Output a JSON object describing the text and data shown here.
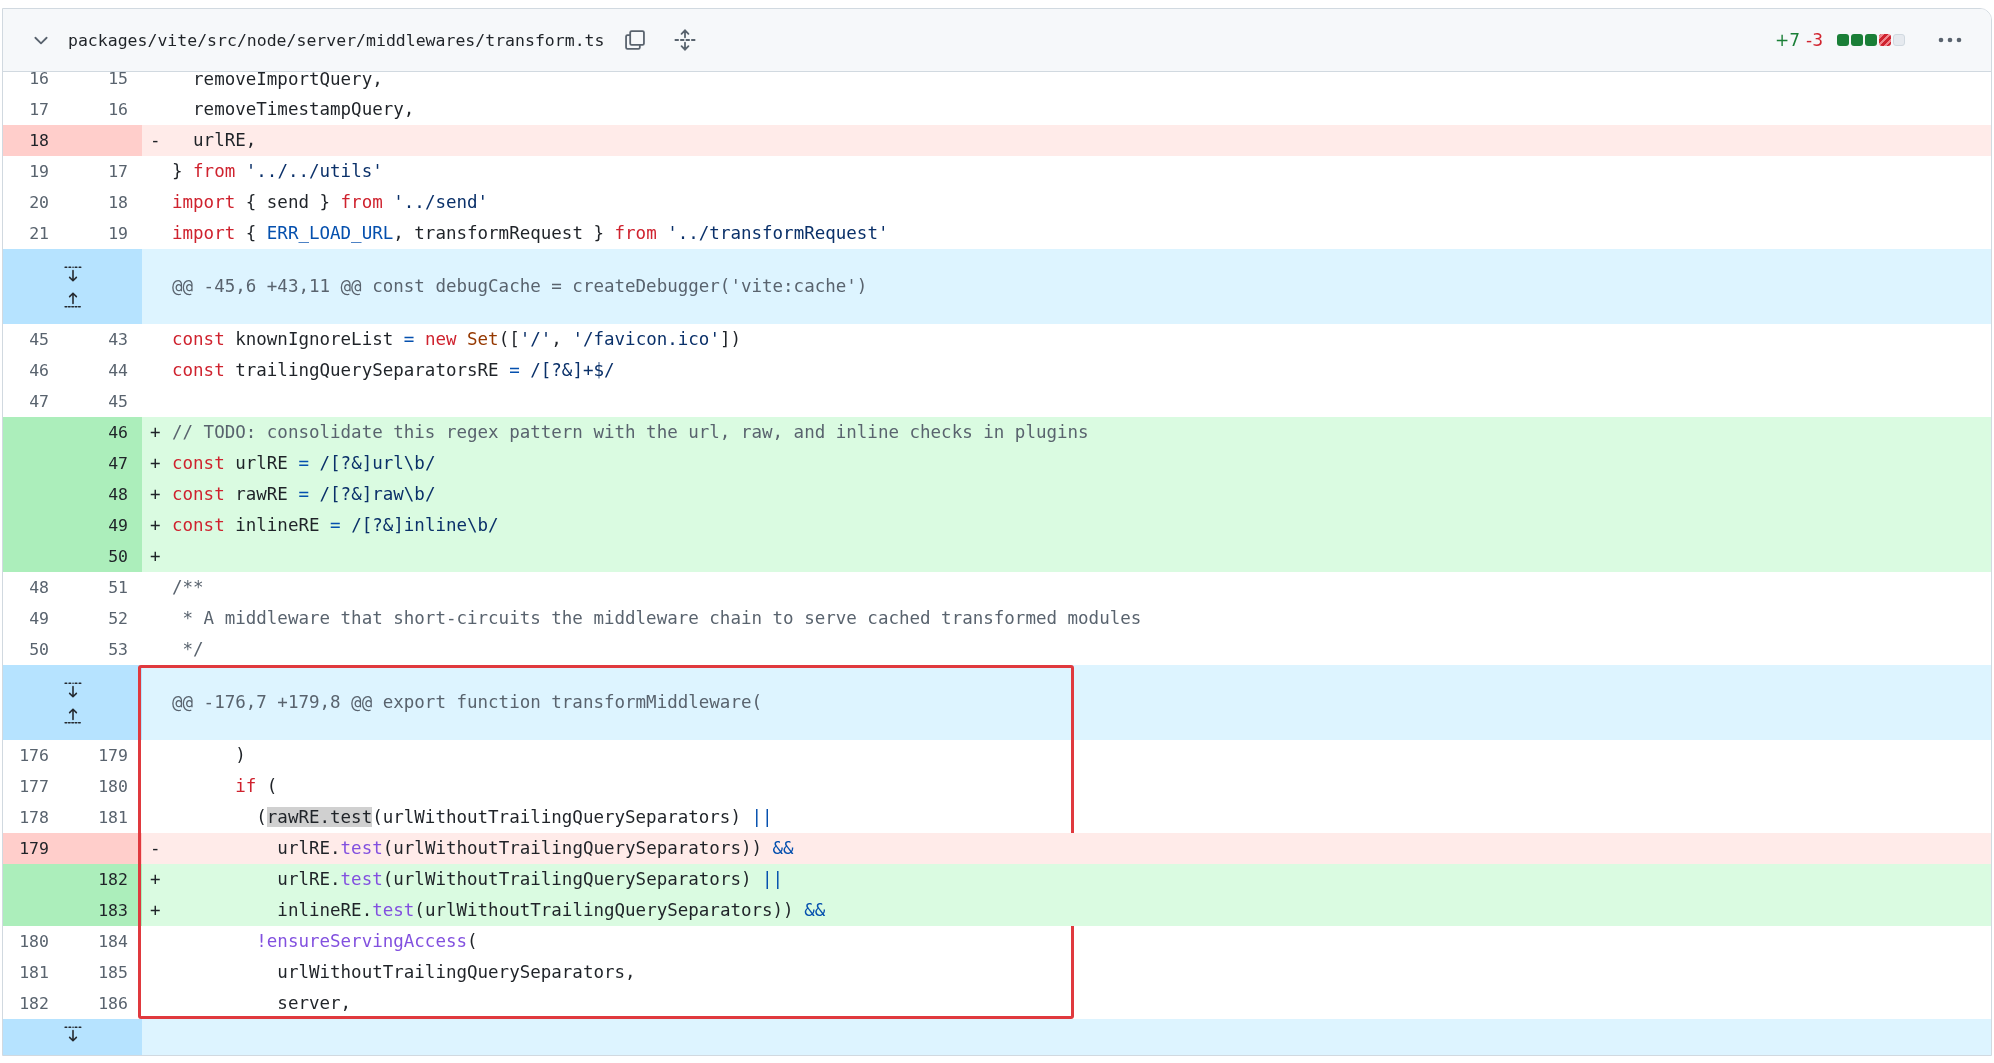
{
  "file_header": {
    "expanded": true,
    "path": "packages/vite/src/node/server/middlewares/transform.ts",
    "additions": "+7",
    "deletions": "-3",
    "diffstat": [
      {
        "kind": "added"
      },
      {
        "kind": "added"
      },
      {
        "kind": "added"
      },
      {
        "kind": "deleted"
      },
      {
        "kind": "neutral"
      }
    ]
  },
  "rows": [
    {
      "kind": "context",
      "old": "16",
      "new": "15",
      "cut": true,
      "tokens": [
        {
          "text": "  removeImportQuery,"
        }
      ]
    },
    {
      "kind": "context",
      "old": "17",
      "new": "16",
      "tokens": [
        {
          "text": "  removeTimestampQuery,"
        }
      ]
    },
    {
      "kind": "deletion",
      "old": "18",
      "marker": "-",
      "tokens": [
        {
          "text": "  urlRE,"
        }
      ]
    },
    {
      "kind": "context",
      "old": "19",
      "new": "17",
      "tokens": [
        {
          "text": "} "
        },
        {
          "kind": "kw",
          "text": "from"
        },
        {
          "kind": "str",
          "text": " '../../utils'"
        }
      ]
    },
    {
      "kind": "context",
      "old": "20",
      "new": "18",
      "tokens": [
        {
          "kind": "kw",
          "text": "import"
        },
        {
          "text": " { send } "
        },
        {
          "kind": "kw",
          "text": "from"
        },
        {
          "kind": "str",
          "text": " '../send'"
        }
      ]
    },
    {
      "kind": "context",
      "old": "21",
      "new": "19",
      "tokens": [
        {
          "kind": "kw",
          "text": "import"
        },
        {
          "text": " { "
        },
        {
          "kind": "const",
          "text": "ERR_LOAD_URL"
        },
        {
          "text": ", transformRequest } "
        },
        {
          "kind": "kw",
          "text": "from"
        },
        {
          "kind": "str",
          "text": " '../transformRequest'"
        }
      ]
    },
    {
      "kind": "hunk",
      "expand_up": true,
      "expand_down": true,
      "text": "@@ -45,6 +43,11 @@ const debugCache = createDebugger('vite:cache')"
    },
    {
      "kind": "context",
      "old": "45",
      "new": "43",
      "tokens": [
        {
          "kind": "kw",
          "text": "const"
        },
        {
          "text": " knownIgnoreList "
        },
        {
          "kind": "const",
          "text": "="
        },
        {
          "kind": "kw",
          "text": " new"
        },
        {
          "kind": "ent",
          "text": " Set"
        },
        {
          "text": "(["
        },
        {
          "kind": "str",
          "text": "'/'"
        },
        {
          "text": ", "
        },
        {
          "kind": "str",
          "text": "'/favicon.ico'"
        },
        {
          "text": "])"
        }
      ]
    },
    {
      "kind": "context",
      "old": "46",
      "new": "44",
      "tokens": [
        {
          "kind": "kw",
          "text": "const"
        },
        {
          "text": " trailingQuerySeparatorsRE "
        },
        {
          "kind": "const",
          "text": "="
        },
        {
          "kind": "str",
          "text": " /[?&]+$/"
        }
      ]
    },
    {
      "kind": "context",
      "old": "47",
      "new": "45"
    },
    {
      "kind": "addition",
      "new": "46",
      "marker": "+",
      "tokens": [
        {
          "kind": "cm",
          "text": "// TODO: consolidate this regex pattern with the url, raw, and inline checks in plugins"
        }
      ]
    },
    {
      "kind": "addition",
      "new": "47",
      "marker": "+",
      "tokens": [
        {
          "kind": "kw",
          "text": "const"
        },
        {
          "text": " urlRE "
        },
        {
          "kind": "const",
          "text": "="
        },
        {
          "kind": "str",
          "text": " /[?&]url\\b/"
        }
      ]
    },
    {
      "kind": "addition",
      "new": "48",
      "marker": "+",
      "tokens": [
        {
          "kind": "kw",
          "text": "const"
        },
        {
          "text": " rawRE "
        },
        {
          "kind": "const",
          "text": "="
        },
        {
          "kind": "str",
          "text": " /[?&]raw\\b/"
        }
      ]
    },
    {
      "kind": "addition",
      "new": "49",
      "marker": "+",
      "tokens": [
        {
          "kind": "kw",
          "text": "const"
        },
        {
          "text": " inlineRE "
        },
        {
          "kind": "const",
          "text": "="
        },
        {
          "kind": "str",
          "text": " /[?&]inline\\b/"
        }
      ]
    },
    {
      "kind": "addition",
      "new": "50",
      "marker": "+"
    },
    {
      "kind": "context",
      "old": "48",
      "new": "51",
      "tokens": [
        {
          "kind": "cm",
          "text": "/**"
        }
      ]
    },
    {
      "kind": "context",
      "old": "49",
      "new": "52",
      "tokens": [
        {
          "kind": "cm",
          "text": " * A middleware that short-circuits the middleware chain to serve cached transformed modules"
        }
      ]
    },
    {
      "kind": "context",
      "old": "50",
      "new": "53",
      "tokens": [
        {
          "kind": "cm",
          "text": " */"
        }
      ]
    },
    {
      "kind": "hunk",
      "expand_up": true,
      "expand_down": true,
      "boxed": true,
      "text": "@@ -176,7 +179,8 @@ export function transformMiddleware("
    },
    {
      "kind": "context",
      "old": "176",
      "new": "179",
      "boxed": true,
      "tokens": [
        {
          "text": "      )"
        }
      ]
    },
    {
      "kind": "context",
      "old": "177",
      "new": "180",
      "boxed": true,
      "tokens": [
        {
          "kind": "kw",
          "text": "      if"
        },
        {
          "text": " ("
        }
      ]
    },
    {
      "kind": "context",
      "old": "178",
      "new": "181",
      "boxed": true,
      "tokens": [
        {
          "text": "        ("
        },
        {
          "kind": "hl",
          "text": "rawRE.test"
        },
        {
          "text": "(urlWithoutTrailingQuerySeparators) "
        },
        {
          "kind": "const",
          "text": "||"
        }
      ]
    },
    {
      "kind": "deletion",
      "old": "179",
      "marker": "-",
      "boxed": true,
      "tokens": [
        {
          "text": "          urlRE."
        },
        {
          "kind": "fn",
          "text": "test"
        },
        {
          "text": "(urlWithoutTrailingQuerySeparators)) "
        },
        {
          "kind": "const",
          "text": "&&"
        }
      ]
    },
    {
      "kind": "addition",
      "new": "182",
      "marker": "+",
      "boxed": true,
      "tokens": [
        {
          "text": "          urlRE."
        },
        {
          "kind": "fn",
          "text": "test"
        },
        {
          "text": "(urlWithoutTrailingQuerySeparators) "
        },
        {
          "kind": "const",
          "text": "||"
        }
      ]
    },
    {
      "kind": "addition",
      "new": "183",
      "marker": "+",
      "boxed": true,
      "tokens": [
        {
          "text": "          inlineRE."
        },
        {
          "kind": "fn",
          "text": "test"
        },
        {
          "text": "(urlWithoutTrailingQuerySeparators)) "
        },
        {
          "kind": "const",
          "text": "&&"
        }
      ]
    },
    {
      "kind": "context",
      "old": "180",
      "new": "184",
      "boxed": true,
      "tokens": [
        {
          "kind": "fn",
          "text": "        !ensureServingAccess"
        },
        {
          "text": "("
        }
      ]
    },
    {
      "kind": "context",
      "old": "181",
      "new": "185",
      "boxed": true,
      "tokens": [
        {
          "text": "          urlWithoutTrailingQuerySeparators,"
        }
      ]
    },
    {
      "kind": "context",
      "old": "182",
      "new": "186",
      "boxed": true,
      "tokens": [
        {
          "text": "          server,"
        }
      ]
    },
    {
      "kind": "hunk",
      "expand_up": false,
      "expand_down": true,
      "cut": true
    }
  ]
}
